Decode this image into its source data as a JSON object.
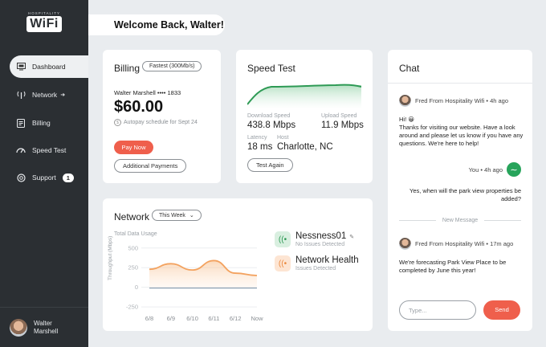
{
  "sidebar": {
    "logo_small": "HOSPITALITY",
    "logo_main": "WiFi",
    "items": [
      {
        "label": "Dashboard",
        "icon": "monitor-icon"
      },
      {
        "label": "Network",
        "icon": "antenna-icon",
        "extra": "arrow-icon"
      },
      {
        "label": "Billing",
        "icon": "bill-icon"
      },
      {
        "label": "Speed Test",
        "icon": "speedometer-icon"
      },
      {
        "label": "Support",
        "icon": "support-icon",
        "badge": "1"
      }
    ],
    "user": {
      "first": "Walter",
      "last": "Marshell"
    }
  },
  "header": {
    "welcome": "Welcome Back, Walter!"
  },
  "billing": {
    "title": "Billing",
    "plan": "Fastest (300Mb/s)",
    "account": "Walter Marshell •••• 1833",
    "amount": "$60.00",
    "autopay": "Autopay schedule for Sept 24",
    "pay_now": "Pay Now",
    "additional": "Additional Payments"
  },
  "speed_test": {
    "title": "Speed Test",
    "download_label": "Download Speed",
    "download_value": "438.8 Mbps",
    "upload_label": "Upload Speed",
    "upload_value": "11.9 Mbps",
    "latency_label": "Latency",
    "latency_value": "18 ms",
    "host_label": "Host",
    "host_value": "Charlotte, NC",
    "test_again": "Test Again"
  },
  "network": {
    "title": "Network",
    "period": "This Week",
    "total_label": "Total Data Usage",
    "ylabel": "Throughput (Mbps)",
    "items": [
      {
        "name": "Nessness01",
        "status": "No Issues Detected",
        "color": "#2e9a55"
      },
      {
        "name": "Network Health",
        "status": "Issues Detected",
        "color": "#ec8a3f"
      }
    ]
  },
  "chart_data": {
    "type": "area",
    "x": [
      "6/8",
      "6/9",
      "6/10",
      "6/11",
      "6/12",
      "Now"
    ],
    "yticks": [
      500,
      250,
      0,
      -250
    ],
    "ylim": [
      -300,
      600
    ],
    "ylabel": "Throughput (Mbps)",
    "title": "Total Data Usage",
    "series": [
      {
        "values": [
          230,
          300,
          220,
          340,
          180,
          150
        ],
        "color": "#f3a25f"
      },
      {
        "values": [
          -10,
          -10,
          -10,
          -10,
          -10,
          -10
        ],
        "color": "#8fa3b5"
      }
    ]
  },
  "chat": {
    "title": "Chat",
    "messages": [
      {
        "from": "Fred From Hospitality Wifi",
        "time": "4h ago",
        "text": "Hi! 😀\nThanks for visiting our website. Have a look around and please let us know if you have any questions. We're here to help!"
      },
      {
        "from": "You",
        "time": "4h ago",
        "text": "Yes, when will the park view properties be added?"
      },
      {
        "from": "Fred From Hospitality Wifi",
        "time": "17m ago",
        "text": "We're forecasting Park View Place to be completed by June this year!"
      }
    ],
    "new_message": "New Message",
    "input_placeholder": "Type...",
    "send": "Send"
  }
}
